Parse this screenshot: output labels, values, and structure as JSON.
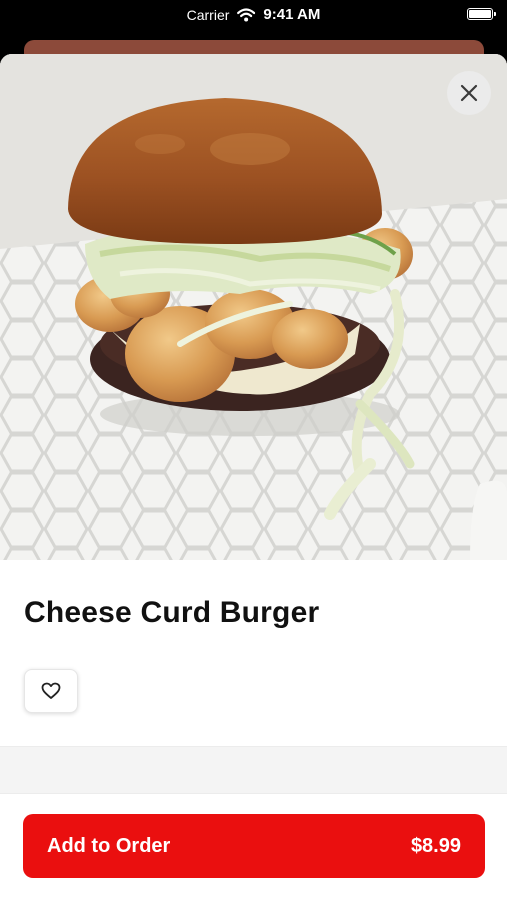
{
  "status_bar": {
    "carrier": "Carrier",
    "time": "9:41 AM"
  },
  "item": {
    "name": "Cheese Curd Burger",
    "image_icon": "burger-photo",
    "favorite_icon": "heart-outline-icon"
  },
  "actions": {
    "close_icon": "close-icon",
    "add_label": "Add to Order",
    "price": "$8.99"
  },
  "colors": {
    "accent": "#ea0f0f",
    "band": "#f4f4f4"
  }
}
